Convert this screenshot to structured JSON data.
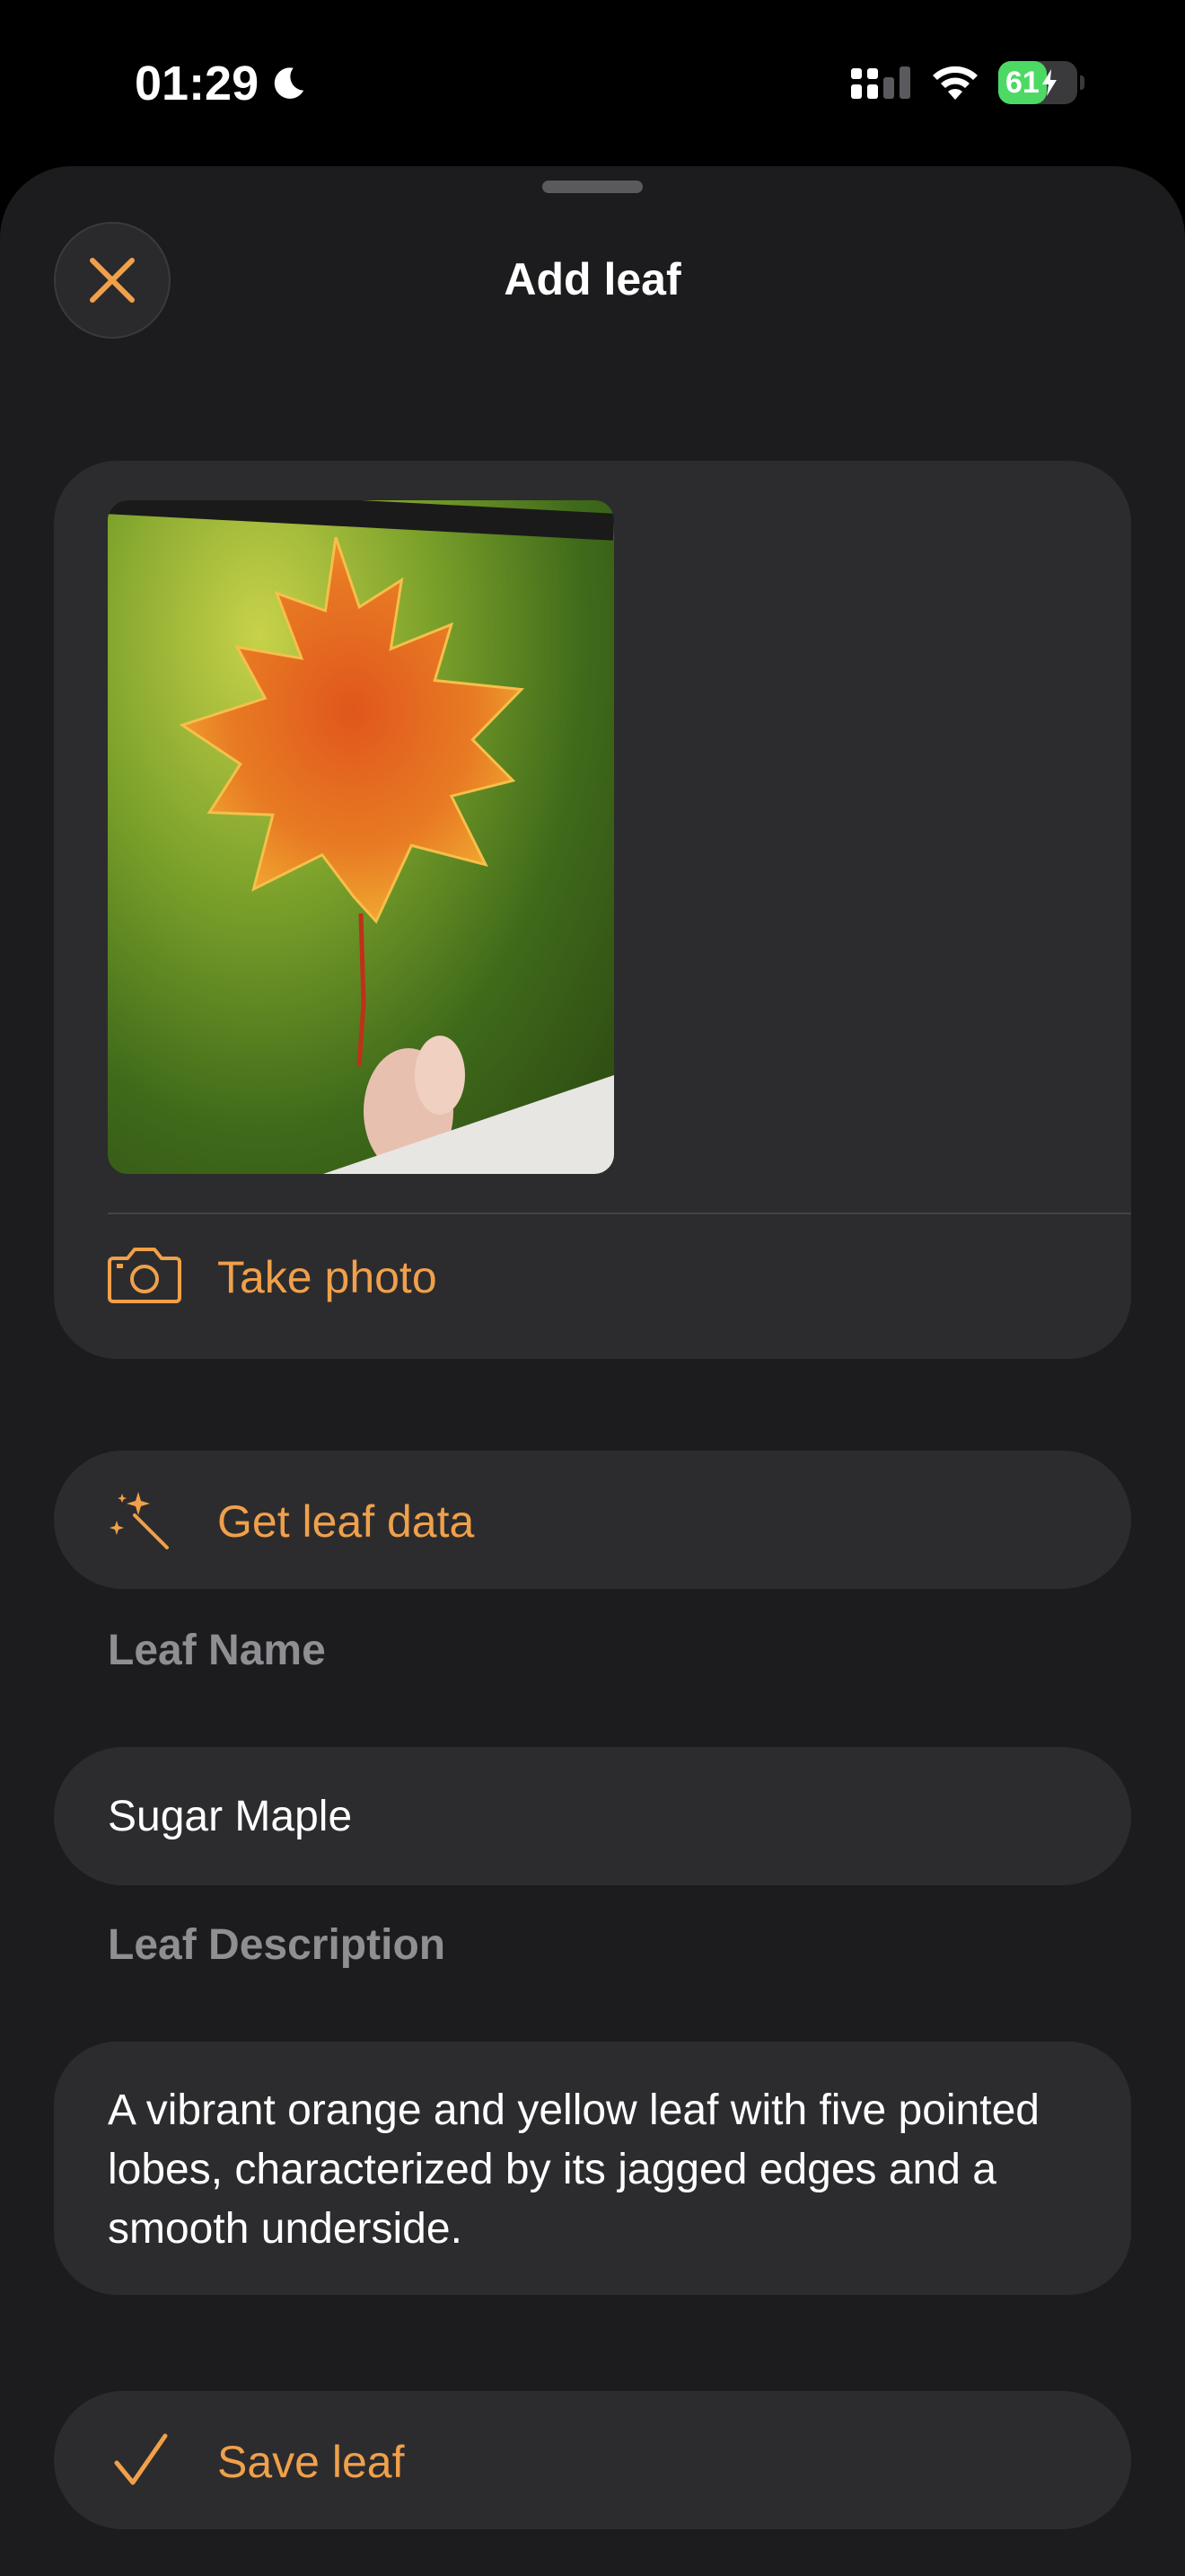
{
  "status": {
    "time": "01:29",
    "battery": "61"
  },
  "sheet": {
    "title": "Add leaf"
  },
  "photo_section": {
    "take_photo_label": "Take photo"
  },
  "actions": {
    "get_data_label": "Get leaf data",
    "save_label": "Save leaf"
  },
  "form": {
    "name_label": "Leaf Name",
    "name_value": "Sugar Maple",
    "description_label": "Leaf Description",
    "description_value": "A vibrant orange and yellow leaf with five pointed lobes, characterized by its jagged edges and a smooth underside."
  },
  "colors": {
    "accent": "#f0a04b",
    "background": "#1c1c1e",
    "card": "#2c2c2e",
    "battery_green": "#4cd964"
  },
  "icons": [
    "moon-icon",
    "cellular-icon",
    "wifi-icon",
    "battery-icon",
    "close-icon",
    "camera-icon",
    "magic-wand-icon",
    "checkmark-icon"
  ],
  "battery_level": 0.61
}
